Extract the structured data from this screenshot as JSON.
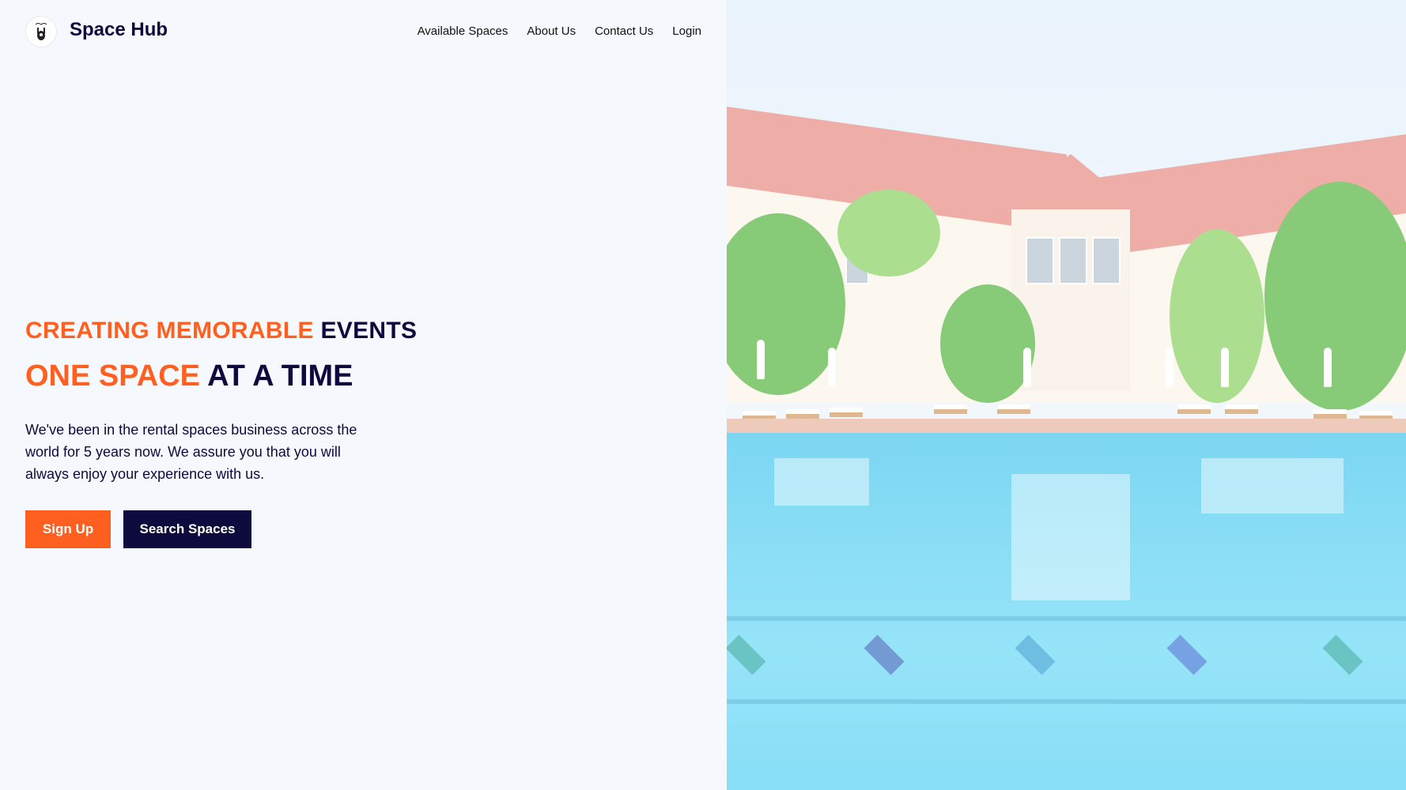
{
  "brand": {
    "name": "Space Hub",
    "logo_icon": "hand-logo-icon"
  },
  "nav": {
    "items": [
      "Available Spaces",
      "About Us",
      "Contact Us",
      "Login"
    ]
  },
  "hero": {
    "line1_orange": "CREATING MEMORABLE",
    "line1_navy": "EVENTS",
    "line2_orange": "ONE SPACE",
    "line2_navy": "AT A TIME",
    "description": "We've been in the rental spaces business across the world for 5 years now. We assure you that you will always enjoy your experience with us."
  },
  "buttons": {
    "signup": "Sign Up",
    "search": "Search Spaces"
  },
  "colors": {
    "accent": "#ff5f1f",
    "navy": "#0d0b3d",
    "background": "#f5f8fc"
  }
}
